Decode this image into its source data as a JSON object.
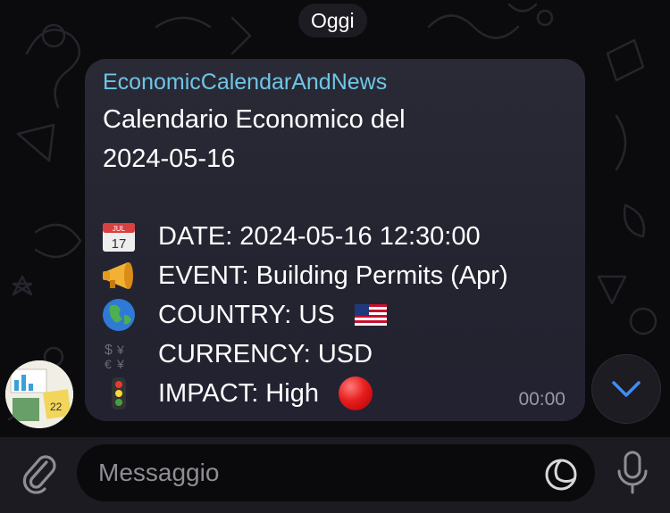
{
  "chat": {
    "date_separator": "Oggi"
  },
  "message": {
    "sender": "EconomicCalendarAndNews",
    "title_line1": "Calendario Economico del",
    "title_line2": "2024-05-16",
    "rows": [
      {
        "icon": "calendar-icon",
        "emoji": "📅",
        "text": "DATE: 2024-05-16 12:30:00"
      },
      {
        "icon": "megaphone-icon",
        "emoji": "📣",
        "text": "EVENT: Building Permits (Apr)"
      },
      {
        "icon": "globe-icon",
        "emoji": "🌍",
        "text": "COUNTRY: US"
      },
      {
        "icon": "currency-exchange-icon",
        "emoji": "💱",
        "text": "CURRENCY: USD"
      },
      {
        "icon": "traffic-light-icon",
        "emoji": "🚦",
        "text": "IMPACT: High"
      }
    ],
    "country_flag": "us-flag-icon",
    "impact_indicator": "red-circle-icon",
    "impact_color": "#e61e1e",
    "time": "00:00"
  },
  "composer": {
    "placeholder": "Messaggio"
  },
  "colors": {
    "sender": "#6ec6e6",
    "bubble": "#2a2a36",
    "accent": "#3e8ef7"
  }
}
